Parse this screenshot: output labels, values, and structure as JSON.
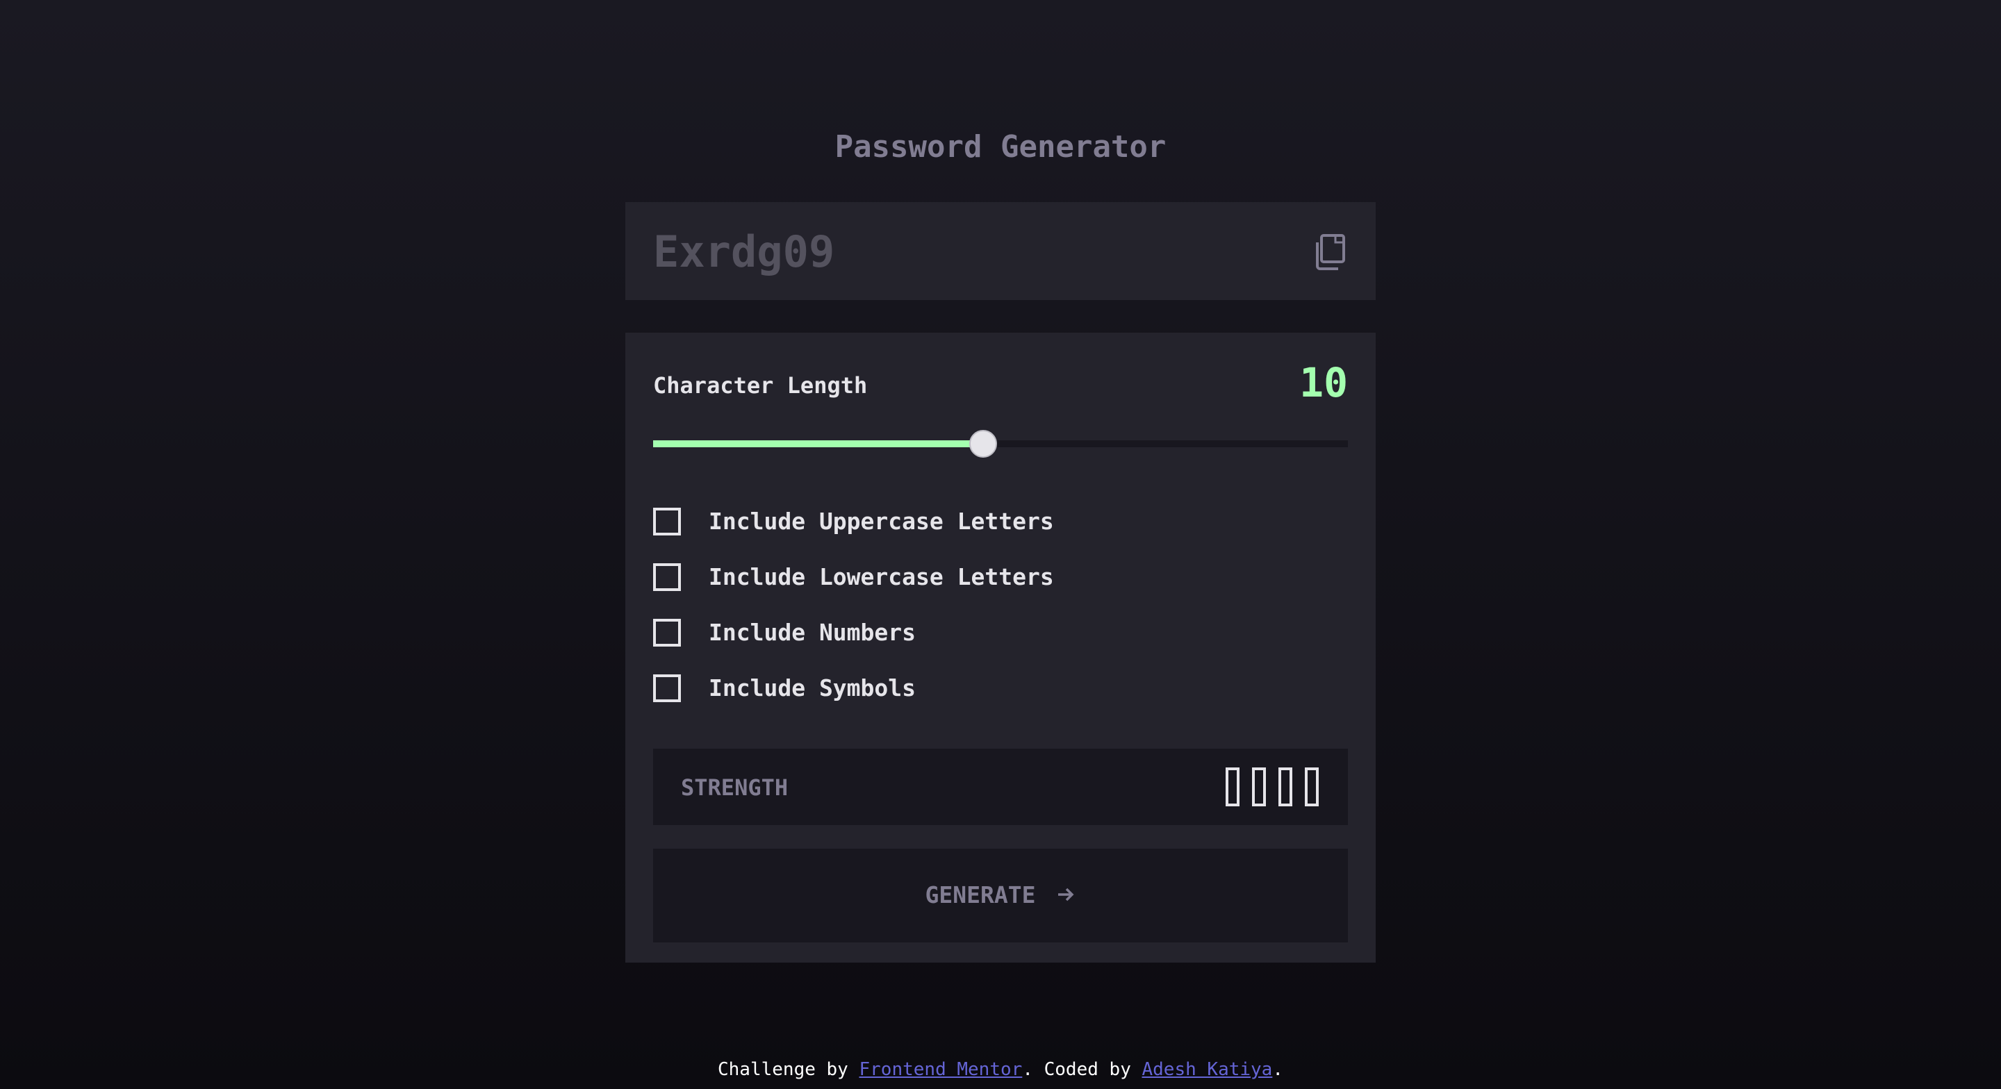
{
  "app": {
    "title": "Password Generator"
  },
  "password": {
    "value": "Exrdg09",
    "copy_icon": "copy-icon"
  },
  "length": {
    "label": "Character Length",
    "value": "10",
    "slider_fraction": 0.475
  },
  "options": [
    {
      "label": "Include Uppercase Letters",
      "checked": false
    },
    {
      "label": "Include Lowercase Letters",
      "checked": false
    },
    {
      "label": "Include Numbers",
      "checked": false
    },
    {
      "label": "Include Symbols",
      "checked": false
    }
  ],
  "strength": {
    "label": "STRENGTH",
    "level": "",
    "bars_filled": 0,
    "bars_total": 4
  },
  "generate": {
    "label": "GENERATE",
    "icon": "arrow-right-icon"
  },
  "footer": {
    "prefix": "Challenge by ",
    "link1": "Frontend Mentor",
    "middle": ". Coded by ",
    "link2": "Adesh Katiya",
    "suffix": "."
  },
  "colors": {
    "accent": "#a4ffaf",
    "background": "#18171f",
    "panel": "#24232c",
    "muted": "#817d92",
    "text": "#e6e5ea",
    "link": "#6565d6"
  }
}
